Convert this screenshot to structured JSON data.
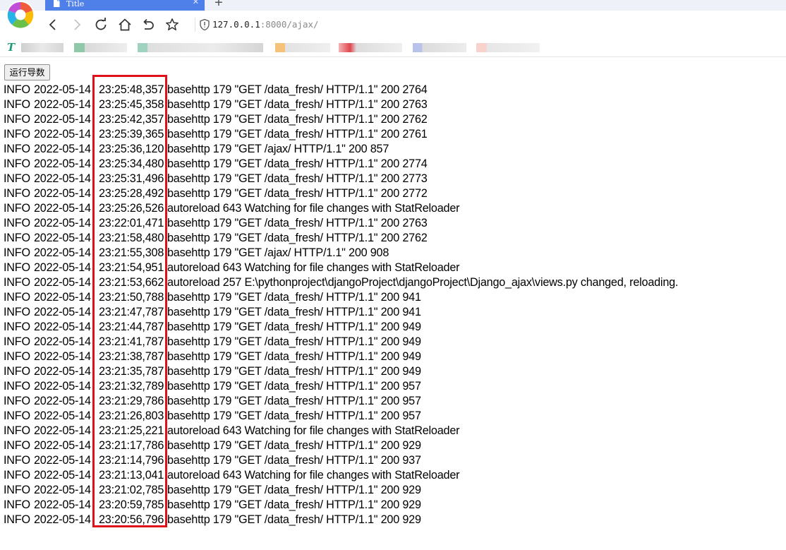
{
  "browser": {
    "tab_title": "Title",
    "new_tab_label": "+",
    "address_host": "127.0.0.1",
    "address_port": ":8000",
    "address_path": "/ajax/",
    "bookmark_logo": "T"
  },
  "colors": {
    "tab_active": "#4f7fe9",
    "highlight_border": "#e0101a",
    "bookmark_logo": "#1e9b7b"
  },
  "icons": [
    "browser-logo-icon",
    "tab-page-icon",
    "back-icon",
    "forward-icon",
    "reload-icon",
    "home-icon",
    "undo-close-icon",
    "star-icon",
    "shield-icon"
  ],
  "page": {
    "run_button_label": "运行导数",
    "highlight_box": "timestamp column",
    "log_lines": [
      {
        "level": "INFO",
        "date": "2022-05-14",
        "time": "23:25:48,357",
        "rest": "basehttp 179 \"GET /data_fresh/ HTTP/1.1\" 200 2764"
      },
      {
        "level": "INFO",
        "date": "2022-05-14",
        "time": "23:25:45,358",
        "rest": "basehttp 179 \"GET /data_fresh/ HTTP/1.1\" 200 2763"
      },
      {
        "level": "INFO",
        "date": "2022-05-14",
        "time": "23:25:42,357",
        "rest": "basehttp 179 \"GET /data_fresh/ HTTP/1.1\" 200 2762"
      },
      {
        "level": "INFO",
        "date": "2022-05-14",
        "time": "23:25:39,365",
        "rest": "basehttp 179 \"GET /data_fresh/ HTTP/1.1\" 200 2761"
      },
      {
        "level": "INFO",
        "date": "2022-05-14",
        "time": "23:25:36,120",
        "rest": "basehttp 179 \"GET /ajax/ HTTP/1.1\" 200 857"
      },
      {
        "level": "INFO",
        "date": "2022-05-14",
        "time": "23:25:34,480",
        "rest": "basehttp 179 \"GET /data_fresh/ HTTP/1.1\" 200 2774"
      },
      {
        "level": "INFO",
        "date": "2022-05-14",
        "time": "23:25:31,496",
        "rest": "basehttp 179 \"GET /data_fresh/ HTTP/1.1\" 200 2773"
      },
      {
        "level": "INFO",
        "date": "2022-05-14",
        "time": "23:25:28,492",
        "rest": "basehttp 179 \"GET /data_fresh/ HTTP/1.1\" 200 2772"
      },
      {
        "level": "INFO",
        "date": "2022-05-14",
        "time": "23:25:26,526",
        "rest": "autoreload 643 Watching for file changes with StatReloader"
      },
      {
        "level": "INFO",
        "date": "2022-05-14",
        "time": "23:22:01,471",
        "rest": "basehttp 179 \"GET /data_fresh/ HTTP/1.1\" 200 2763"
      },
      {
        "level": "INFO",
        "date": "2022-05-14",
        "time": "23:21:58,480",
        "rest": "basehttp 179 \"GET /data_fresh/ HTTP/1.1\" 200 2762"
      },
      {
        "level": "INFO",
        "date": "2022-05-14",
        "time": "23:21:55,308",
        "rest": "basehttp 179 \"GET /ajax/ HTTP/1.1\" 200 908"
      },
      {
        "level": "INFO",
        "date": "2022-05-14",
        "time": "23:21:54,951",
        "rest": "autoreload 643 Watching for file changes with StatReloader"
      },
      {
        "level": "INFO",
        "date": "2022-05-14",
        "time": "23:21:53,662",
        "rest": "autoreload 257 E:\\pythonproject\\djangoProject\\djangoProject\\Django_ajax\\views.py changed, reloading."
      },
      {
        "level": "INFO",
        "date": "2022-05-14",
        "time": "23:21:50,788",
        "rest": "basehttp 179 \"GET /data_fresh/ HTTP/1.1\" 200 941"
      },
      {
        "level": "INFO",
        "date": "2022-05-14",
        "time": "23:21:47,787",
        "rest": "basehttp 179 \"GET /data_fresh/ HTTP/1.1\" 200 941"
      },
      {
        "level": "INFO",
        "date": "2022-05-14",
        "time": "23:21:44,787",
        "rest": "basehttp 179 \"GET /data_fresh/ HTTP/1.1\" 200 949"
      },
      {
        "level": "INFO",
        "date": "2022-05-14",
        "time": "23:21:41,787",
        "rest": "basehttp 179 \"GET /data_fresh/ HTTP/1.1\" 200 949"
      },
      {
        "level": "INFO",
        "date": "2022-05-14",
        "time": "23:21:38,787",
        "rest": "basehttp 179 \"GET /data_fresh/ HTTP/1.1\" 200 949"
      },
      {
        "level": "INFO",
        "date": "2022-05-14",
        "time": "23:21:35,787",
        "rest": "basehttp 179 \"GET /data_fresh/ HTTP/1.1\" 200 949"
      },
      {
        "level": "INFO",
        "date": "2022-05-14",
        "time": "23:21:32,789",
        "rest": "basehttp 179 \"GET /data_fresh/ HTTP/1.1\" 200 957"
      },
      {
        "level": "INFO",
        "date": "2022-05-14",
        "time": "23:21:29,786",
        "rest": "basehttp 179 \"GET /data_fresh/ HTTP/1.1\" 200 957"
      },
      {
        "level": "INFO",
        "date": "2022-05-14",
        "time": "23:21:26,803",
        "rest": "basehttp 179 \"GET /data_fresh/ HTTP/1.1\" 200 957"
      },
      {
        "level": "INFO",
        "date": "2022-05-14",
        "time": "23:21:25,221",
        "rest": "autoreload 643 Watching for file changes with StatReloader"
      },
      {
        "level": "INFO",
        "date": "2022-05-14",
        "time": "23:21:17,786",
        "rest": "basehttp 179 \"GET /data_fresh/ HTTP/1.1\" 200 929"
      },
      {
        "level": "INFO",
        "date": "2022-05-14",
        "time": "23:21:14,796",
        "rest": "basehttp 179 \"GET /data_fresh/ HTTP/1.1\" 200 937"
      },
      {
        "level": "INFO",
        "date": "2022-05-14",
        "time": "23:21:13,041",
        "rest": "autoreload 643 Watching for file changes with StatReloader"
      },
      {
        "level": "INFO",
        "date": "2022-05-14",
        "time": "23:21:02,785",
        "rest": "basehttp 179 \"GET /data_fresh/ HTTP/1.1\" 200 929"
      },
      {
        "level": "INFO",
        "date": "2022-05-14",
        "time": "23:20:59,785",
        "rest": "basehttp 179 \"GET /data_fresh/ HTTP/1.1\" 200 929"
      },
      {
        "level": "INFO",
        "date": "2022-05-14",
        "time": "23:20:56,796",
        "rest": "basehttp 179 \"GET /data_fresh/ HTTP/1.1\" 200 929"
      }
    ]
  }
}
